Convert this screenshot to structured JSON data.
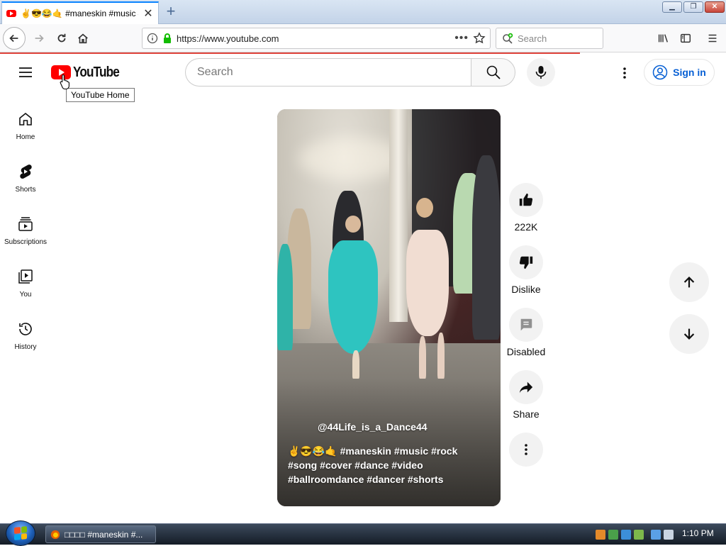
{
  "browser": {
    "tab_title": "✌😎😂🤙 #maneskin #music #",
    "tab_close": "✕",
    "new_tab": "+",
    "url": "https://www.youtube.com",
    "url_more": "•••",
    "search_placeholder": "Search"
  },
  "youtube": {
    "logo_text": "YouTube",
    "logo_tooltip": "YouTube Home",
    "search_placeholder": "Search",
    "sign_in_label": "Sign in",
    "guide": [
      {
        "label": "Home",
        "icon": "home-icon"
      },
      {
        "label": "Shorts",
        "icon": "shorts-icon"
      },
      {
        "label": "Subscriptions",
        "icon": "subscriptions-icon"
      },
      {
        "label": "You",
        "icon": "you-icon"
      },
      {
        "label": "History",
        "icon": "history-icon"
      }
    ],
    "short": {
      "channel": "@44Life_is_a_Dance44",
      "description": "✌😎😂🤙 #maneskin #music #rock #song #cover #dance #video #ballroomdance #dancer #shorts"
    },
    "actions": {
      "likes": "222K",
      "dislike": "Dislike",
      "comments": "Disabled",
      "share": "Share"
    }
  },
  "taskbar": {
    "window_label": "□□□□ #maneskin #...",
    "clock": "1:10 PM"
  },
  "colors": {
    "youtube_red": "#ff0000",
    "link_blue": "#065fd4",
    "load_bar": "#e0453c"
  }
}
